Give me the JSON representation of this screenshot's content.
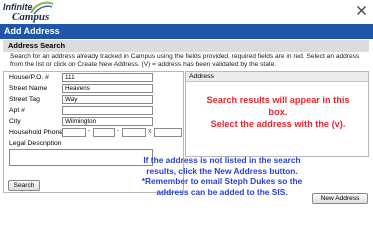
{
  "app": {
    "logo_line1": "Infinite",
    "logo_line2": "Campus"
  },
  "dialog": {
    "title": "Add Address",
    "section_title": "Address Search",
    "instructions": "Search for an address already tracked in Campus using the fields provided, required fields are in red. Select an address from the list or click on Create New Address. (V) = address has been validated by the state."
  },
  "form": {
    "house_label": "House/P.O. #",
    "house_value": "111",
    "street_name_label": "Street Name",
    "street_name_value": "Heavens",
    "street_tag_label": "Street Tag",
    "street_tag_value": "Way",
    "apt_label": "Apt #",
    "apt_value": "",
    "city_label": "City",
    "city_value": "Wilmington",
    "phone_label": "Household Phone",
    "phone_area": "",
    "phone_prefix": "",
    "phone_line": "",
    "phone_ext_label": "x",
    "phone_ext": "",
    "legal_label": "Legal Description",
    "legal_value": "",
    "search_button": "Search"
  },
  "results": {
    "header": "Address",
    "overlay_line1": "Search results will appear in this",
    "overlay_line2": "box.",
    "overlay_line3": "Select the address with the (v)."
  },
  "note": {
    "line1": "If the address is not listed in the search",
    "line2": "results, click the New Address button.",
    "line3": "*Remember to email Steph Dukes so the",
    "line4": "address can be added to the SIS."
  },
  "buttons": {
    "new_address": "New Address"
  },
  "colors": {
    "title_bar": "#1f56a8",
    "red_note": "#e8252b",
    "blue_note": "#2a3fd8"
  }
}
